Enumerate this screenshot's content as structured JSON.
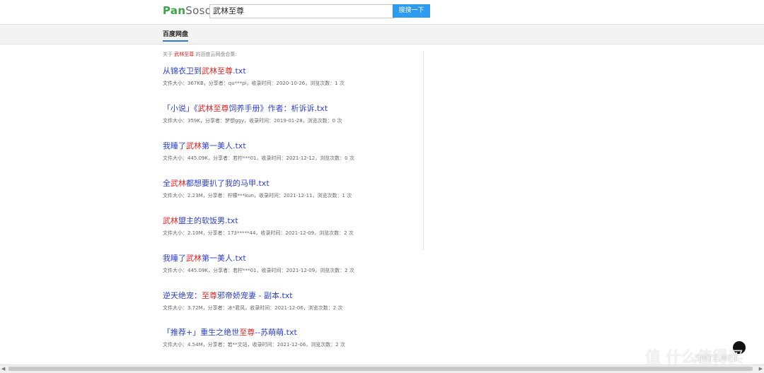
{
  "header": {
    "logo_part1": "Pan",
    "logo_part2": "Soso",
    "search_value": "武林至尊",
    "search_button": "搜搜一下"
  },
  "tabs": {
    "active": "百度网盘"
  },
  "intro": {
    "prefix": "关于",
    "keyword": "武林至尊",
    "suffix": "的百度云网盘合集:"
  },
  "results": [
    {
      "t1": "从锦衣卫到",
      "hl": "武林至尊",
      "t2": ".txt",
      "meta": "文件大小：367KB，分享者：qu***pi，收录时间：2020-10-26，浏览次数：1 次"
    },
    {
      "t1": "「小说」《",
      "hl": "武林至尊",
      "t2": "饲养手册》作者：析诉诉.txt",
      "meta": "文件大小：359K，分享者：梦想ggy，收录时间：2019-01-28，浏览次数：0 次"
    },
    {
      "t1": "我睡了",
      "hl": "武林",
      "t2": "第一美人.txt",
      "meta": "文件大小：445.09K，分享者：若柠***01，收录时间：2021-12-12，浏览次数：0 次"
    },
    {
      "t1": "全",
      "hl": "武林",
      "t2": "都想要扒了我的马甲.txt",
      "meta": "文件大小：2.23M，分享者：柠檬***kun，收录时间：2021-12-11，浏览次数：1 次"
    },
    {
      "t1": "",
      "hl": "武林",
      "t2": "盟主的软饭男.txt",
      "meta": "文件大小：2.10M，分享者：173*****44，收录时间：2021-12-09，浏览次数：2 次"
    },
    {
      "t1": "我睡了",
      "hl": "武林",
      "t2": "第一美人.txt",
      "meta": "文件大小：445.09K，分享者：若柠***01，收录时间：2021-12-09，浏览次数：2 次"
    },
    {
      "t1": "逆天绝宠：",
      "hl": "至尊",
      "t2": "邪帝娇宠妻 - 副本.txt",
      "meta": "文件大小：3.72M，分享者：冰*君风，收录时间：2021-12-06，浏览次数：2 次"
    },
    {
      "t1": "「推荐+」重生之绝世",
      "hl": "至尊",
      "t2": "--苏萌萌.txt",
      "meta": "文件大小：4.54M，分享者：若**文站，收录时间：2021-12-06，浏览次数：2 次"
    }
  ],
  "watermark": "值 什么值得买",
  "watermark_site": "SMYZ.NET"
}
